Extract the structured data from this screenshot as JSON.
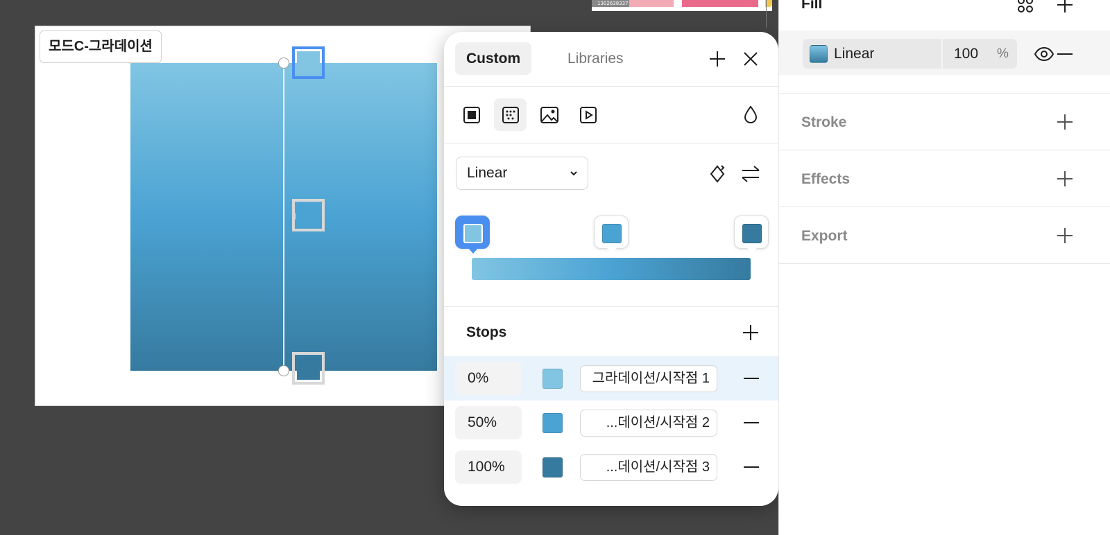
{
  "thumbnail": {
    "label": "1302638337"
  },
  "canvas": {
    "frame_label": "모드C-그라데이션",
    "gradient_colors": [
      "#81c5e3",
      "#4ba3d3",
      "#367a9f"
    ]
  },
  "picker": {
    "tabs": {
      "custom": "Custom",
      "libraries": "Libraries"
    },
    "icons": {
      "add": "plus-icon",
      "close": "close-icon",
      "solid": "solid-fill-icon",
      "gradient": "gradient-fill-icon",
      "image": "image-fill-icon",
      "video": "video-fill-icon",
      "eyedropper": "eyedropper-icon",
      "rotate": "rotate-gradient-icon",
      "flip": "flip-gradient-icon"
    },
    "gradient_type": "Linear",
    "stops_title": "Stops",
    "stops": [
      {
        "position": "0%",
        "color": "#81c5e3",
        "token": "그라데이션/시작점 1"
      },
      {
        "position": "50%",
        "color": "#4ba3d3",
        "token": "...데이션/시작점 2"
      },
      {
        "position": "100%",
        "color": "#367a9f",
        "token": "...데이션/시작점 3"
      }
    ]
  },
  "panel": {
    "fill_title": "Fill",
    "fill_type": "Linear",
    "opacity": "100",
    "opacity_unit": "%",
    "stroke_title": "Stroke",
    "effects_title": "Effects",
    "export_title": "Export"
  },
  "colors": {
    "accent": "#4a8ff0",
    "selected_row": "#e9f3fc"
  }
}
